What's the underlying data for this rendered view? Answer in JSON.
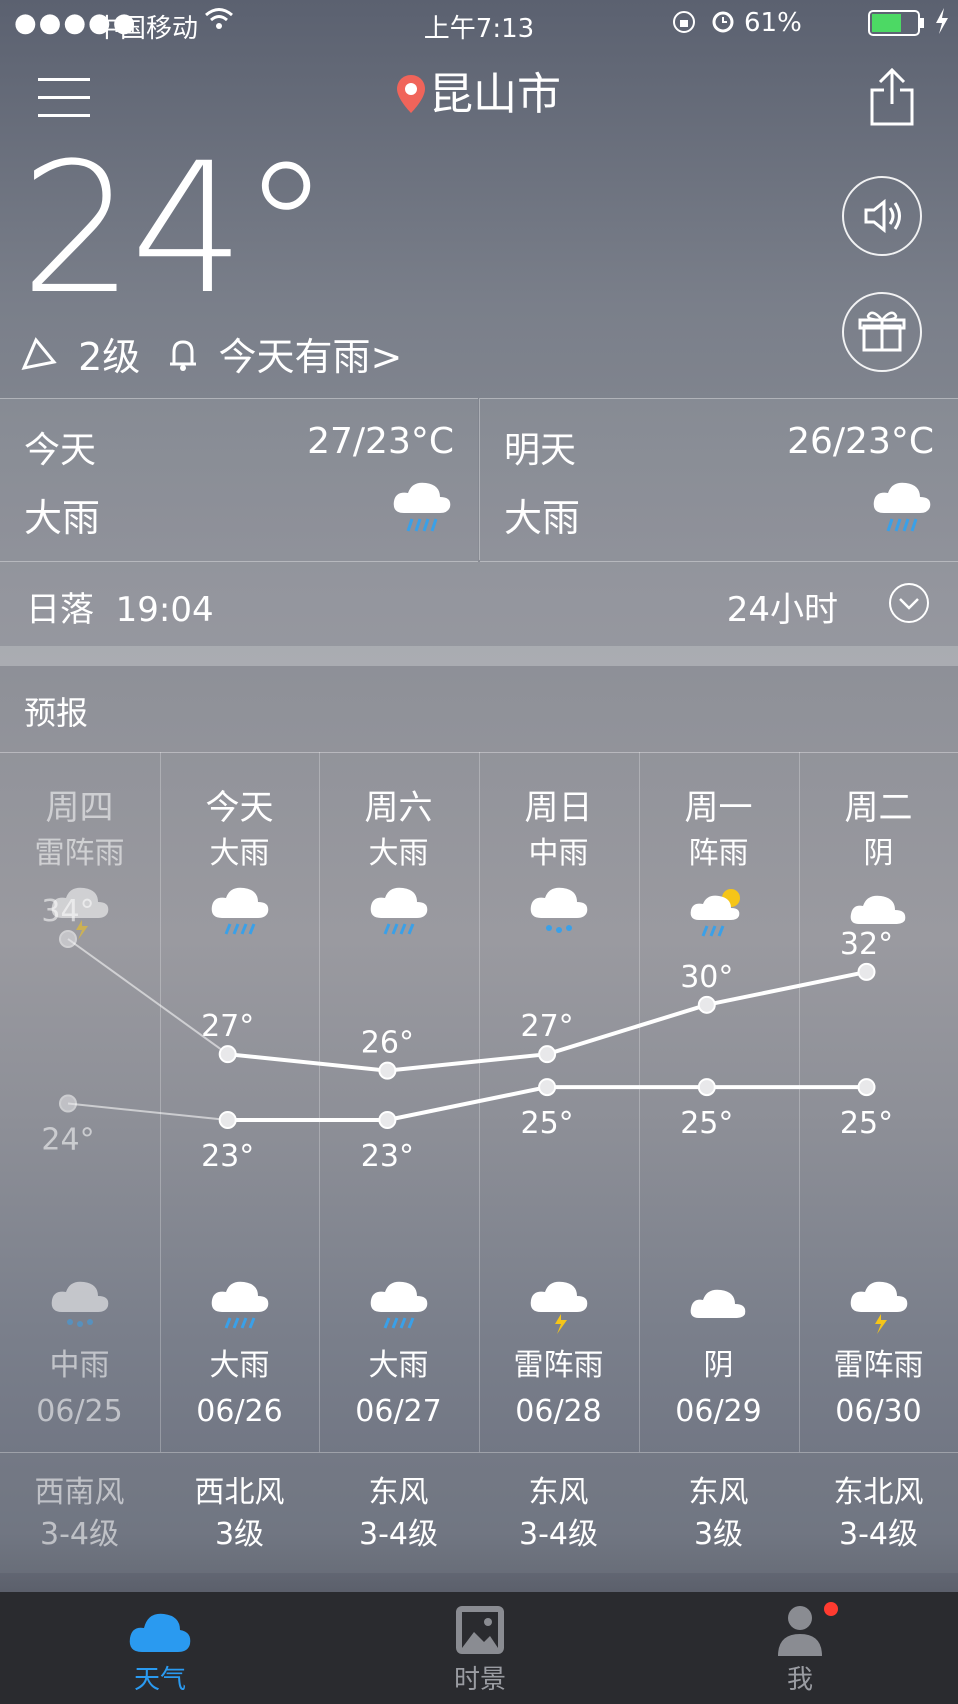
{
  "status_bar": {
    "carrier": "中国移动",
    "time": "上午7:13",
    "battery": "61%"
  },
  "header": {
    "city": "昆山市",
    "temperature": "24°",
    "wind_level": "2级",
    "alert": "今天有雨",
    "alert_arrow": ">"
  },
  "today": {
    "label": "今天",
    "range": "27/23°C",
    "condition": "大雨",
    "icon": "heavy-rain-icon"
  },
  "tomorrow": {
    "label": "明天",
    "range": "26/23°C",
    "condition": "大雨",
    "icon": "heavy-rain-icon"
  },
  "sunset": {
    "label": "日落",
    "time": "19:04",
    "toggle": "24小时"
  },
  "forecast": {
    "title": "预报",
    "days": [
      {
        "day": "周四",
        "day_cond": "雷阵雨",
        "day_icon": "thunderstorm-icon",
        "high": "34°",
        "low": "24°",
        "night_icon": "moderate-rain-icon",
        "night_cond": "中雨",
        "date": "06/25",
        "wind_dir": "西南风",
        "wind_level": "3-4级",
        "past": true
      },
      {
        "day": "今天",
        "day_cond": "大雨",
        "day_icon": "heavy-rain-icon",
        "high": "27°",
        "low": "23°",
        "night_icon": "heavy-rain-icon",
        "night_cond": "大雨",
        "date": "06/26",
        "wind_dir": "西北风",
        "wind_level": "3级"
      },
      {
        "day": "周六",
        "day_cond": "大雨",
        "day_icon": "heavy-rain-icon",
        "high": "26°",
        "low": "23°",
        "night_icon": "heavy-rain-icon",
        "night_cond": "大雨",
        "date": "06/27",
        "wind_dir": "东风",
        "wind_level": "3-4级"
      },
      {
        "day": "周日",
        "day_cond": "中雨",
        "day_icon": "moderate-rain-icon",
        "high": "27°",
        "low": "25°",
        "night_icon": "thunderstorm-icon",
        "night_cond": "雷阵雨",
        "date": "06/28",
        "wind_dir": "东风",
        "wind_level": "3-4级"
      },
      {
        "day": "周一",
        "day_cond": "阵雨",
        "day_icon": "shower-icon",
        "high": "30°",
        "low": "25°",
        "night_icon": "overcast-icon",
        "night_cond": "阴",
        "date": "06/29",
        "wind_dir": "东风",
        "wind_level": "3级"
      },
      {
        "day": "周二",
        "day_cond": "阴",
        "day_icon": "overcast-icon",
        "high": "32°",
        "low": "25°",
        "night_icon": "thunderstorm-icon",
        "night_cond": "雷阵雨",
        "date": "06/30",
        "wind_dir": "东北风",
        "wind_level": "3-4级"
      }
    ]
  },
  "chart_data": {
    "type": "line",
    "x": [
      "06/25",
      "06/26",
      "06/27",
      "06/28",
      "06/29",
      "06/30"
    ],
    "series": [
      {
        "values": [
          34,
          27,
          26,
          27,
          30,
          32
        ]
      },
      {
        "values": [
          24,
          23,
          23,
          25,
          25,
          25
        ]
      }
    ]
  },
  "tabbar": {
    "tabs": [
      {
        "label": "天气",
        "icon": "cloud-icon",
        "active": true
      },
      {
        "label": "时景",
        "icon": "photo-icon"
      },
      {
        "label": "我",
        "icon": "user-icon"
      }
    ]
  },
  "colors": {
    "accent": "#2a9af0",
    "badge": "#ff3b30",
    "battery": "#4cd964"
  }
}
